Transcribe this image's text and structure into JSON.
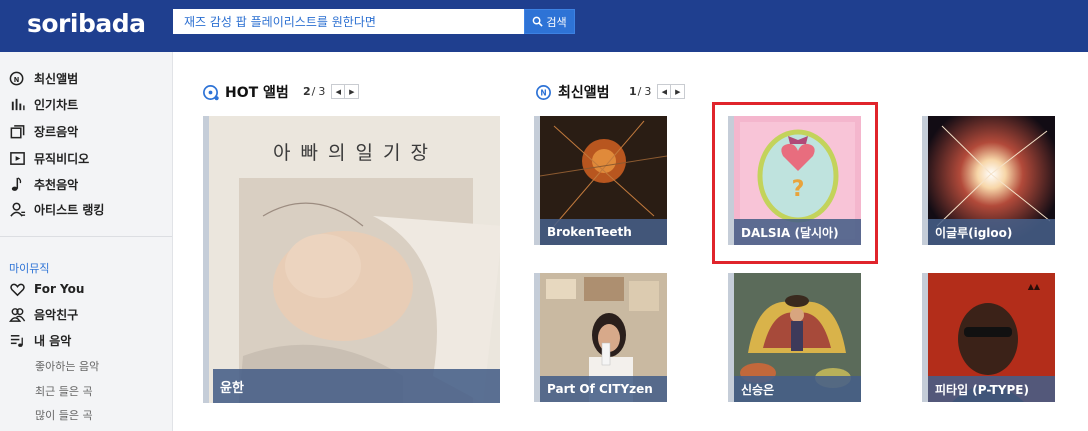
{
  "header": {
    "logo": "soribada",
    "search_placeholder": "재즈 감성 팝 플레이리스트를 원한다면",
    "search_button": "검색"
  },
  "sidebar": {
    "main_items": [
      {
        "label": "최신앨범",
        "icon": "new-album-icon"
      },
      {
        "label": "인기차트",
        "icon": "chart-icon"
      },
      {
        "label": "장르음악",
        "icon": "genre-icon"
      },
      {
        "label": "뮤직비디오",
        "icon": "video-icon"
      },
      {
        "label": "추천음악",
        "icon": "music-note-icon"
      },
      {
        "label": "아티스트 랭킹",
        "icon": "artist-icon"
      }
    ],
    "section_label": "마이뮤직",
    "my_items": [
      {
        "label": "For You",
        "icon": "heart-icon"
      },
      {
        "label": "음악친구",
        "icon": "friends-icon"
      },
      {
        "label": "내 음악",
        "icon": "playlist-icon"
      }
    ],
    "sub_items": [
      "좋아하는 음악",
      "최근 들은 곡",
      "많이 들은 곡"
    ]
  },
  "hot": {
    "title": "HOT 앨범",
    "page_current": "2",
    "page_total": "3",
    "album": {
      "caption": "윤한",
      "art_text": "아 빠 의 일 기 장"
    }
  },
  "new": {
    "title": "최신앨범",
    "page_current": "1",
    "page_total": "3",
    "albums": [
      {
        "caption": "BrokenTeeth"
      },
      {
        "caption": "DALSIA (달시아)"
      },
      {
        "caption": "이글루(igloo)"
      },
      {
        "caption": "Part Of CITYzen"
      },
      {
        "caption": "신승은"
      },
      {
        "caption": "피타입 (P-TYPE)"
      }
    ]
  },
  "colors": {
    "header_bg": "#1f3f8f",
    "accent": "#2e73d6",
    "highlight": "#e0242b"
  }
}
